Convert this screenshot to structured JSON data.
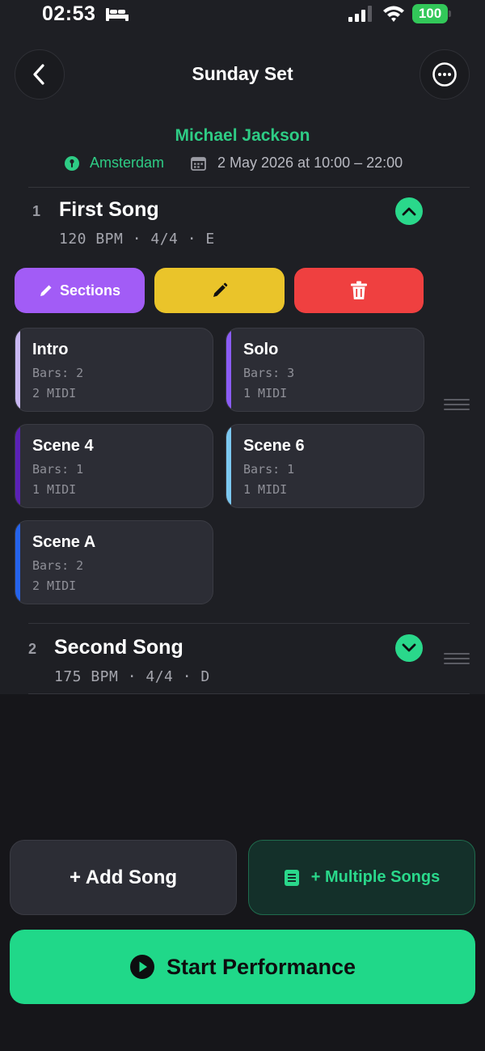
{
  "status_bar": {
    "time": "02:53",
    "battery": "100"
  },
  "header": {
    "title": "Sunday Set",
    "back_icon": "chevron-left-icon",
    "more_icon": "ellipsis-circle-icon"
  },
  "event": {
    "artist": "Michael Jackson",
    "location": "Amsterdam",
    "datetime": "2 May 2026 at 10:00 – 22:00"
  },
  "songs": [
    {
      "number": "1",
      "title": "First Song",
      "meta": "120 BPM · 4/4 · E",
      "expanded": true,
      "actions": {
        "sections_label": "Sections"
      },
      "sections": [
        {
          "name": "Intro",
          "bars": "Bars: 2",
          "midi": "2 MIDI",
          "color": "#c9b8f2"
        },
        {
          "name": "Solo",
          "bars": "Bars: 3",
          "midi": "1 MIDI",
          "color": "#8b5cf6"
        },
        {
          "name": "Scene 4",
          "bars": "Bars: 1",
          "midi": "1 MIDI",
          "color": "#5b21b6"
        },
        {
          "name": "Scene 6",
          "bars": "Bars: 1",
          "midi": "1 MIDI",
          "color": "#7cc8f0"
        },
        {
          "name": "Scene A",
          "bars": "Bars: 2",
          "midi": "2 MIDI",
          "color": "#2563eb"
        }
      ]
    },
    {
      "number": "2",
      "title": "Second Song",
      "meta": "175 BPM · 4/4 · D",
      "expanded": false
    }
  ],
  "bottom": {
    "add_song_label": "+ Add Song",
    "multiple_songs_label": "+ Multiple Songs",
    "start_label": "Start Performance"
  },
  "colors": {
    "accent_green": "#2ad88b",
    "sections_purple": "#a25cf6",
    "edit_yellow": "#eac42a",
    "delete_red": "#ef4040"
  }
}
